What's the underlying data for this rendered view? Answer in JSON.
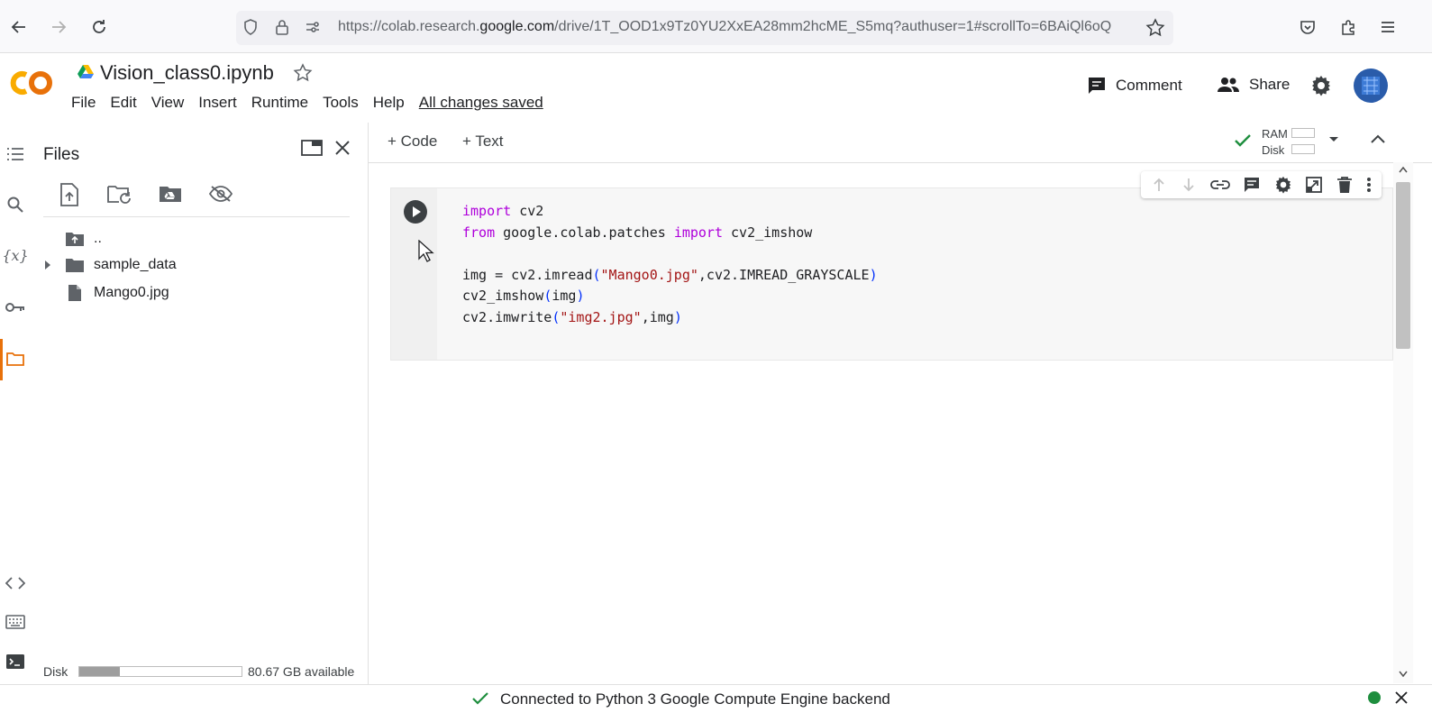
{
  "browser": {
    "url_prefix": "https://colab.research.",
    "url_domain": "google.com",
    "url_suffix": "/drive/1T_OOD1x9Tz0YU2XxEA28mm2hcME_S5mq?authuser=1#scrollTo=6BAiQl6oQ"
  },
  "header": {
    "logo": "CO",
    "notebook_title": "Vision_class0.ipynb",
    "menu": [
      "File",
      "Edit",
      "View",
      "Insert",
      "Runtime",
      "Tools",
      "Help"
    ],
    "save_status": "All changes saved",
    "comment_label": "Comment",
    "share_label": "Share"
  },
  "files_panel": {
    "title": "Files",
    "items": [
      {
        "name": "..",
        "type": "parent-folder"
      },
      {
        "name": "sample_data",
        "type": "folder"
      },
      {
        "name": "Mango0.jpg",
        "type": "file"
      }
    ],
    "disk_label": "Disk",
    "disk_used_fraction": 0.25,
    "disk_available": "80.67 GB available"
  },
  "toolbar": {
    "add_code": "Code",
    "add_text": "Text",
    "ram_label": "RAM",
    "disk_label": "Disk"
  },
  "cell": {
    "code_lines": [
      "import cv2",
      "from google.colab.patches import cv2_imshow",
      "",
      "img = cv2.imread(\"Mango0.jpg\",cv2.IMREAD_GRAYSCALE)",
      "cv2_imshow(img)",
      "cv2.imwrite(\"img2.jpg\",img)"
    ]
  },
  "status": {
    "text": "Connected to Python 3 Google Compute Engine backend"
  },
  "colors": {
    "logo_orange": "#f9ab00",
    "keyword": "#af00db",
    "string": "#a31515",
    "connected_green": "#1e8e3e"
  },
  "icons": {
    "rail": [
      "table-of-contents-icon",
      "search-icon",
      "variables-icon",
      "secrets-key-icon",
      "folder-icon"
    ],
    "rail_bottom": [
      "code-snippets-icon",
      "command-palette-icon",
      "terminal-icon"
    ],
    "files_actions": [
      "upload-file-icon",
      "refresh-folder-icon",
      "mount-drive-icon",
      "hide-files-icon"
    ],
    "cell_toolbar": [
      "move-up-icon",
      "move-down-icon",
      "link-icon",
      "comment-icon",
      "settings-icon",
      "mirror-cell-icon",
      "delete-icon",
      "more-icon"
    ]
  }
}
